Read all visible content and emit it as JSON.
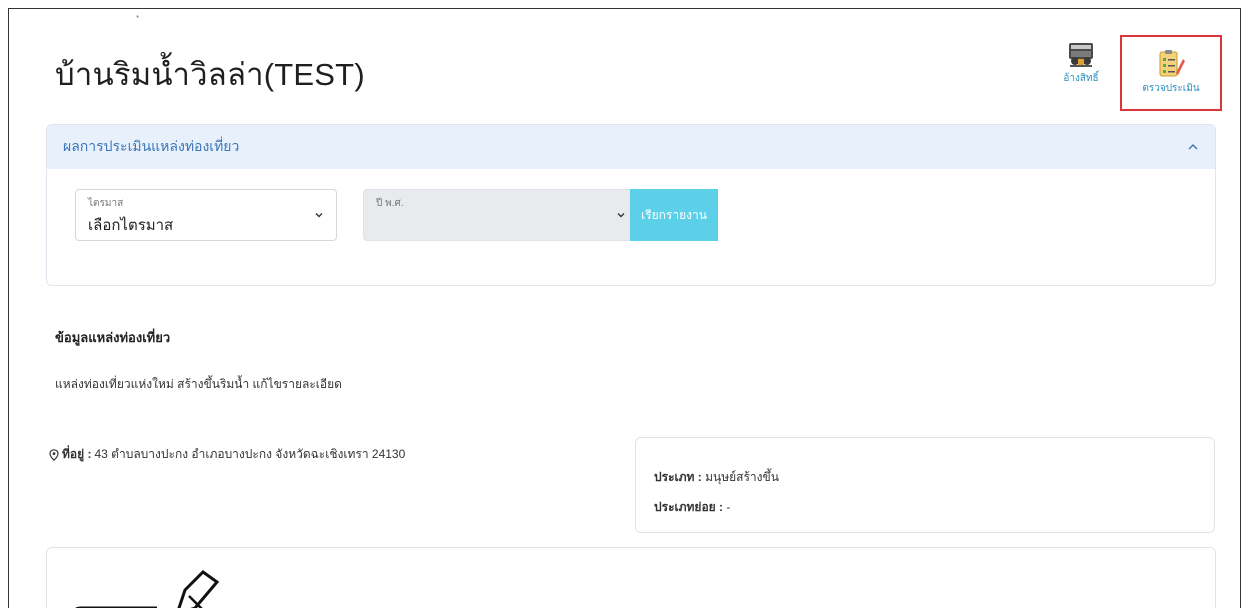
{
  "header": {
    "corner_mark": "ุ",
    "title": "บ้านริมน้ำวิลล่า(TEST)",
    "actions": [
      {
        "label": "อ้างสิทธิ์",
        "icon": "claim-icon"
      },
      {
        "label": "ตรวจประเมิน",
        "icon": "checklist-clipboard-icon",
        "highlighted": true
      }
    ]
  },
  "panel": {
    "title": "ผลการประเมินแหล่งท่องเที่ยว",
    "collapse_icon": "chevron-up-icon",
    "quarter_select": {
      "label": "ไตรมาส",
      "value": "เลือกไตรมาส"
    },
    "year_select": {
      "label": "ปี พ.ศ.",
      "value": "",
      "disabled": true
    },
    "report_button": "เรียกรายงาน"
  },
  "info": {
    "heading": "ข้อมูลแหล่งท่องเที่ยว",
    "description": "แหล่งท่องเที่ยวแห่งใหม่ สร้างขึ้นริมน้ำ แก้ไขรายละเอียด",
    "address_label": "ที่อยู่ :",
    "address_value": "43 ตำบลบางปะกง อำเภอบางปะกง จังหวัดฉะเชิงเทรา 24130"
  },
  "type_card": {
    "type_label": "ประเภท :",
    "type_value": "มนุษย์สร้างขึ้น",
    "subtype_label": "ประเภทย่อย :",
    "subtype_value": "-"
  },
  "colors": {
    "link": "#2b8fbe",
    "panel_header_bg": "#e8f1fb",
    "panel_title": "#3a76b8",
    "report_button_bg": "#5bd0e8",
    "highlight_border": "#d9353a"
  }
}
